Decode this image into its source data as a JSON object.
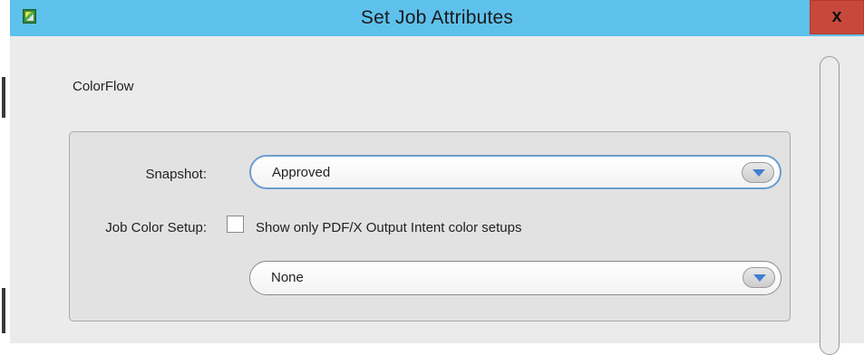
{
  "window": {
    "title": "Set Job Attributes",
    "close_label": "x"
  },
  "section": {
    "title": "ColorFlow"
  },
  "form": {
    "snapshot_label": "Snapshot:",
    "snapshot_value": "Approved",
    "job_color_setup_label": "Job Color Setup:",
    "pdfx_checkbox_label": "Show only PDF/X Output Intent color setups",
    "pdfx_checkbox_checked": false,
    "color_setup_value": "None"
  },
  "colors": {
    "titlebar": "#5ec1ec",
    "close_button": "#c8493c",
    "dialog_background": "#ebebeb",
    "focus_ring": "#6a9ecf",
    "dropdown_arrow": "#3f7fd0"
  },
  "icons": [
    "app-icon",
    "close-icon",
    "chevron-down-icon"
  ]
}
